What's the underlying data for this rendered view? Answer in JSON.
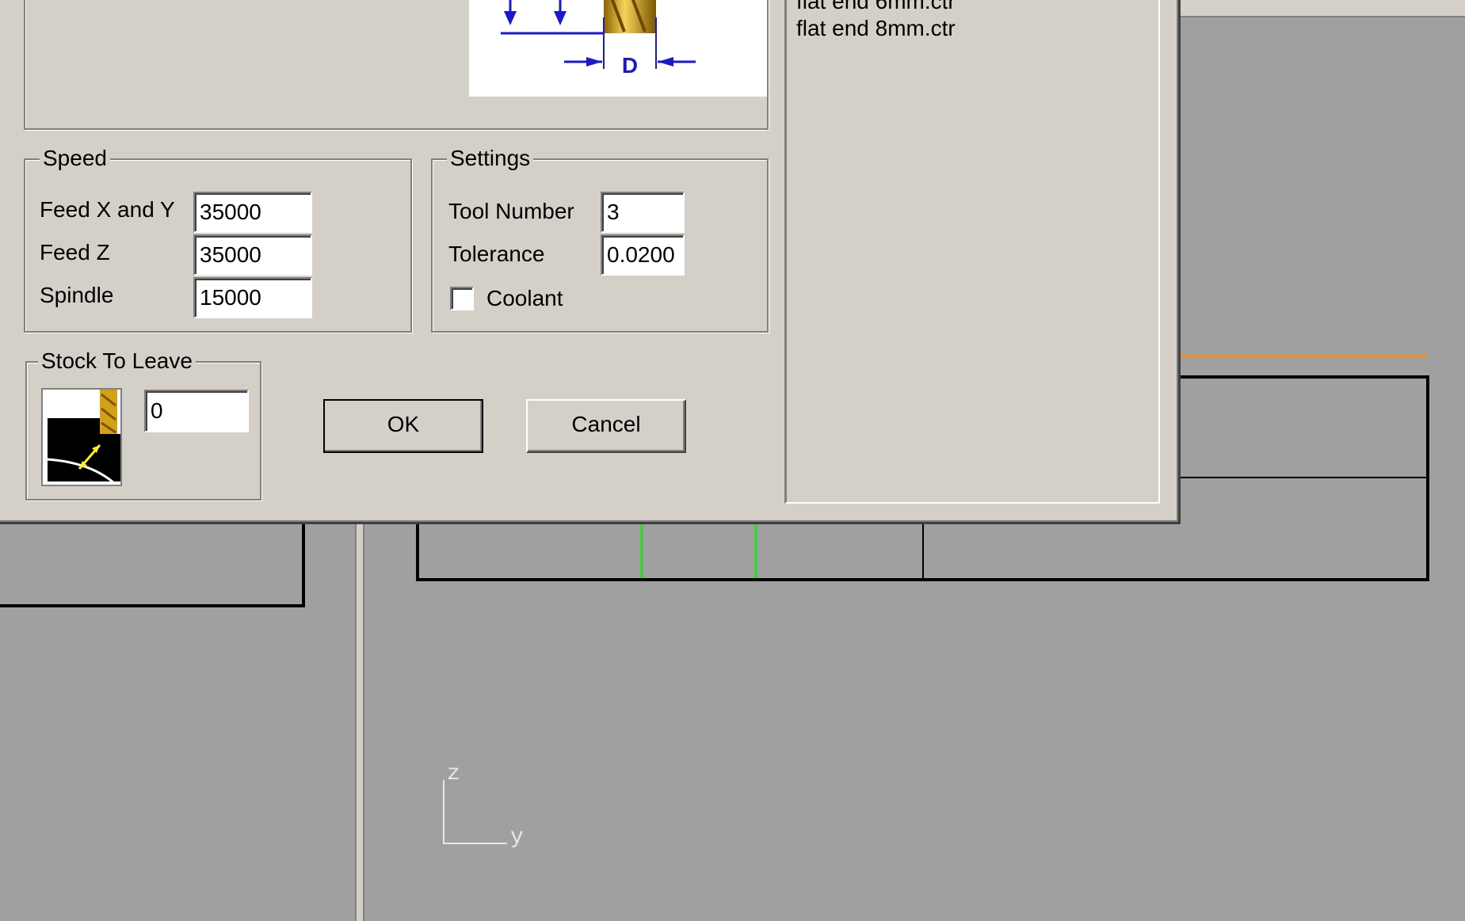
{
  "tool_list": {
    "items": [
      "flat end 6mm.ctr",
      "flat end 8mm.ctr"
    ]
  },
  "tool_diagram": {
    "dimension_label": "D"
  },
  "speed": {
    "title": "Speed",
    "feed_xy_label": "Feed X and Y",
    "feed_xy_value": "35000",
    "feed_z_label": "Feed Z",
    "feed_z_value": "35000",
    "spindle_label": "Spindle",
    "spindle_value": "15000"
  },
  "settings": {
    "title": "Settings",
    "tool_number_label": "Tool Number",
    "tool_number_value": "3",
    "tolerance_label": "Tolerance",
    "tolerance_value": "0.0200",
    "coolant_label": "Coolant",
    "coolant_checked": false
  },
  "stock": {
    "title": "Stock To Leave",
    "value": "0"
  },
  "buttons": {
    "ok": "OK",
    "cancel": "Cancel"
  },
  "viewport": {
    "axis_vertical": "z",
    "axis_horizontal": "y"
  },
  "colors": {
    "dialog": "#d4d0c8",
    "viewport": "#a0a0a0",
    "dimension_blue": "#1a1acc",
    "tool_gold": "#d4a017",
    "orange_line": "#ff8c1a",
    "green_line": "#22dd22"
  }
}
